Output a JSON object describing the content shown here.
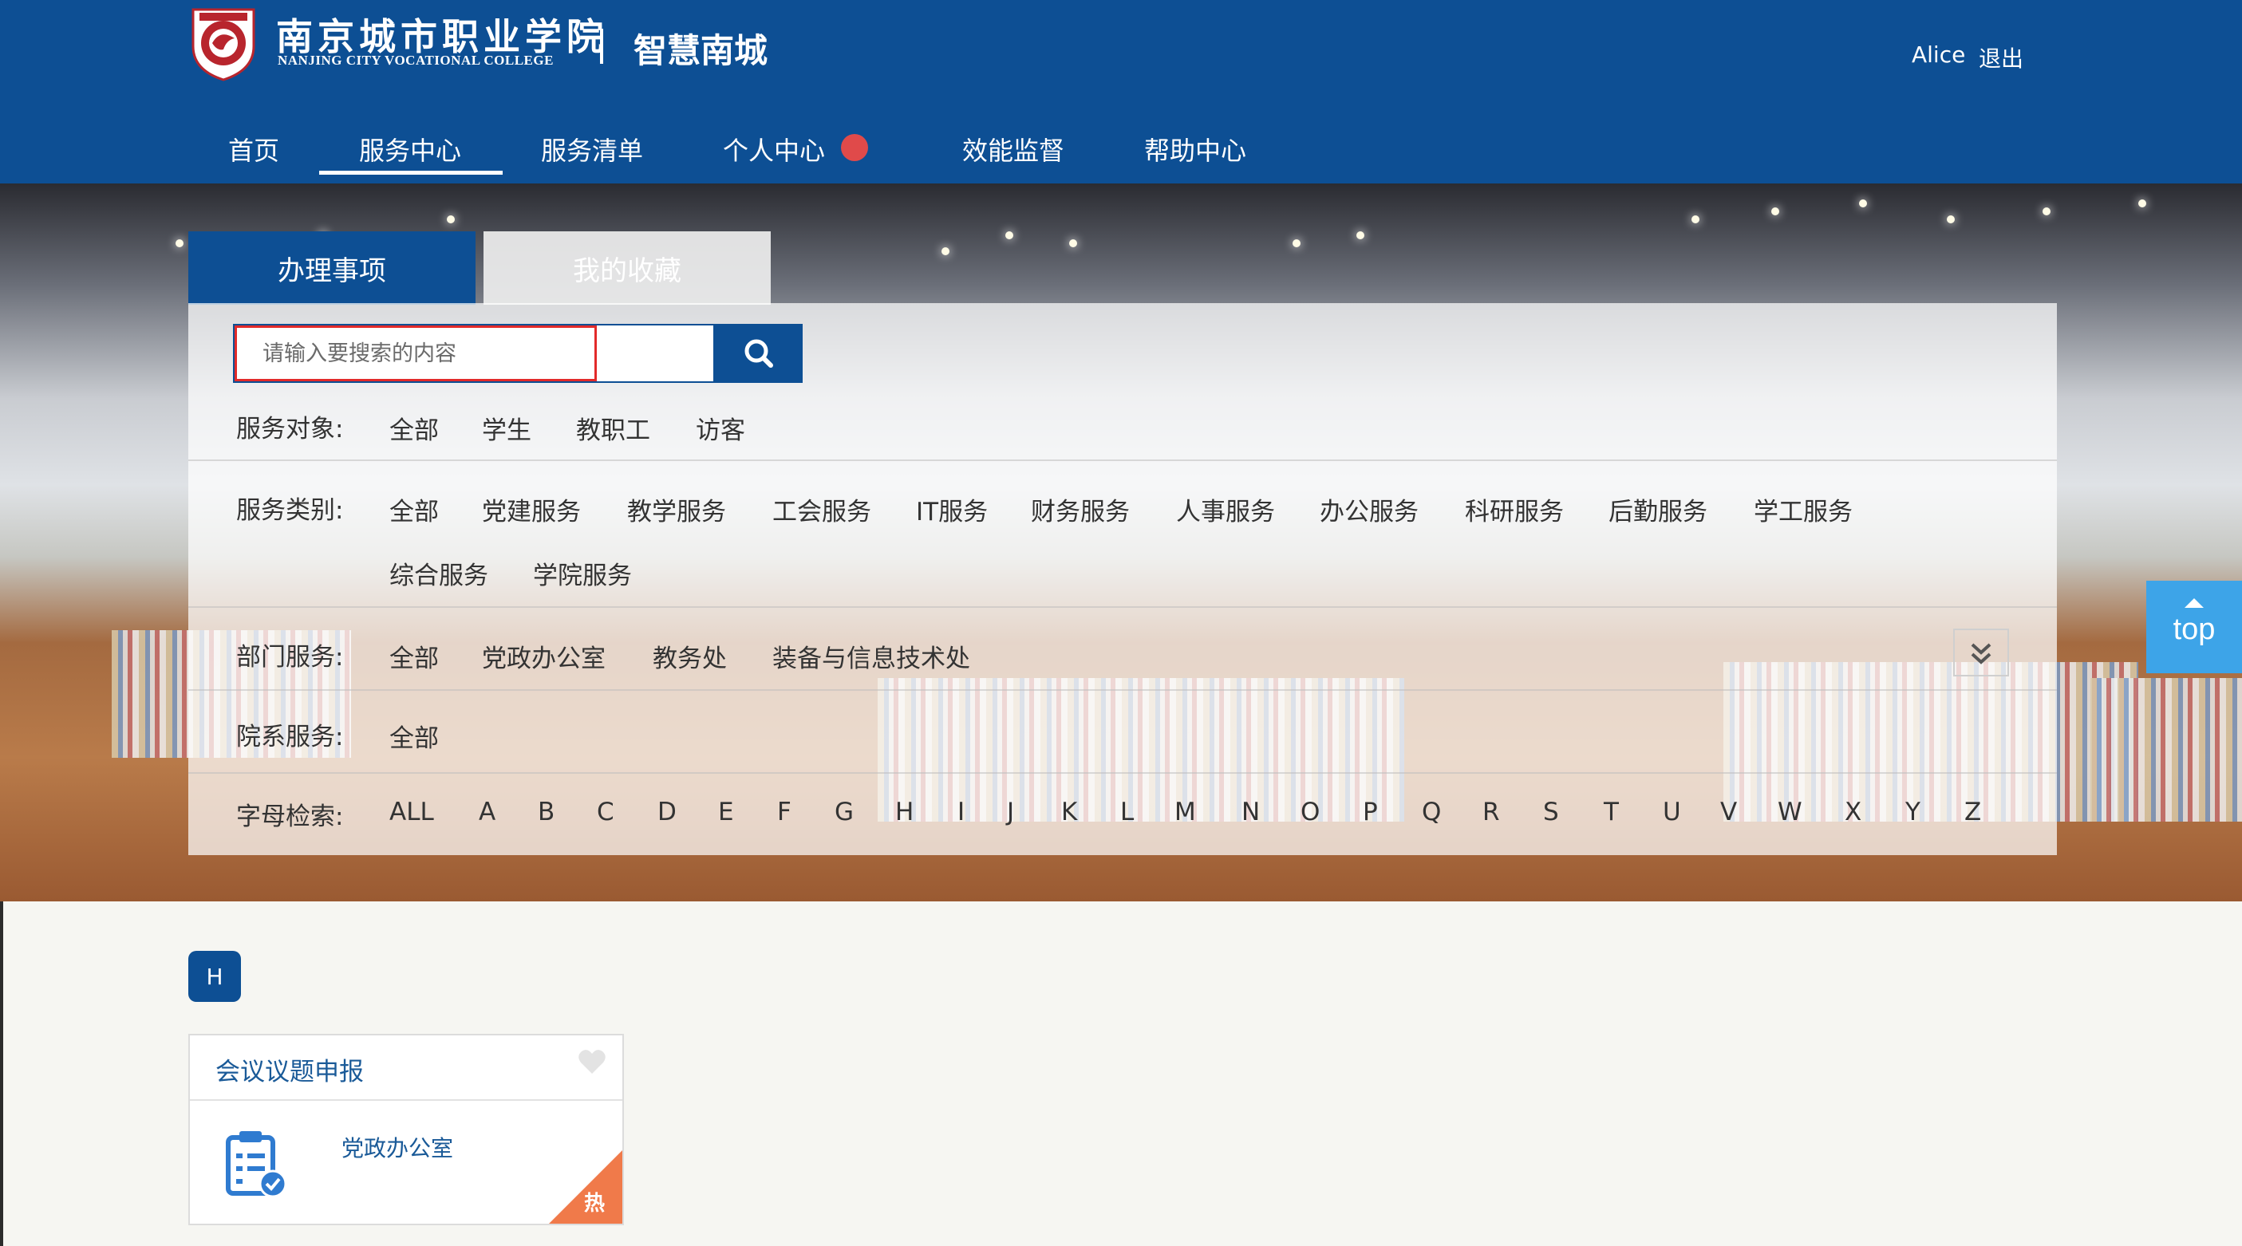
{
  "header": {
    "school_name_cn": "南京城市职业学院",
    "school_name_en": "NANJING CITY VOCATIONAL COLLEGE",
    "site_name": "智慧南城",
    "user_name": "Alice",
    "logout_label": "退出",
    "brand_color": "#0d4f94"
  },
  "nav": {
    "items": [
      {
        "label": "首页"
      },
      {
        "label": "服务中心",
        "active": true
      },
      {
        "label": "服务清单"
      },
      {
        "label": "个人中心",
        "has_badge": true
      },
      {
        "label": "效能监督"
      },
      {
        "label": "帮助中心"
      }
    ],
    "badge_color": "#e04a4a"
  },
  "tabs": {
    "active_label": "办理事项",
    "inactive_label": "我的收藏"
  },
  "search": {
    "placeholder": "请输入要搜索的内容",
    "value": "",
    "button_icon": "search-icon"
  },
  "filters": {
    "target": {
      "label": "服务对象:",
      "options": [
        "全部",
        "学生",
        "教职工",
        "访客"
      ]
    },
    "category": {
      "label": "服务类别:",
      "options": [
        "全部",
        "党建服务",
        "教学服务",
        "工会服务",
        "IT服务",
        "财务服务",
        "人事服务",
        "办公服务",
        "科研服务",
        "后勤服务",
        "学工服务",
        "综合服务",
        "学院服务"
      ]
    },
    "department": {
      "label": "部门服务:",
      "options": [
        "全部",
        "党政办公室",
        "教务处",
        "装备与信息技术处"
      ]
    },
    "college": {
      "label": "院系服务:",
      "options": [
        "全部"
      ]
    },
    "alphabet": {
      "label": "字母检索:",
      "letters": [
        "ALL",
        "A",
        "B",
        "C",
        "D",
        "E",
        "F",
        "G",
        "H",
        "I",
        "J",
        "K",
        "L",
        "M",
        "N",
        "O",
        "P",
        "Q",
        "R",
        "S",
        "T",
        "U",
        "V",
        "W",
        "X",
        "Y",
        "Z"
      ]
    }
  },
  "back_to_top": {
    "label": "top",
    "color": "#3da4e8"
  },
  "results": {
    "group_letter": "H",
    "cards": [
      {
        "title": "会议议题申报",
        "department": "党政办公室",
        "hot_label": "热",
        "icon": "clipboard-check-icon",
        "favorite_icon": "heart-icon"
      }
    ]
  }
}
